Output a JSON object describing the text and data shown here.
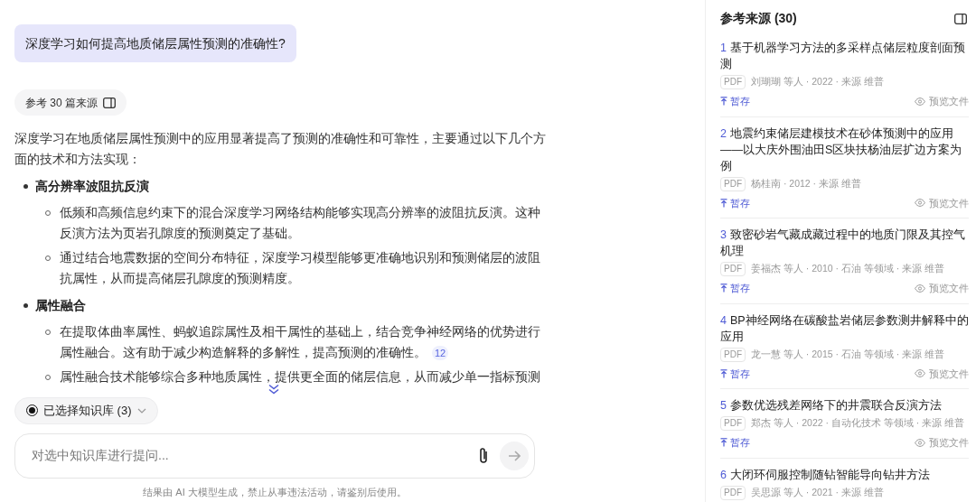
{
  "question": "深度学习如何提高地质储层属性预测的准确性?",
  "sources_chip": {
    "label": "参考 30 篇来源"
  },
  "answer": {
    "intro": "深度学习在地质储层属性预测中的应用显著提高了预测的准确性和可靠性，主要通过以下几个方面的技术和方法实现：",
    "sections": [
      {
        "heading": "高分辨率波阻抗反演",
        "points": [
          {
            "text": "低频和高频信息约束下的混合深度学习网络结构能够实现高分辨率的波阻抗反演。这种反演方法为页岩孔隙度的预测奠定了基础。"
          },
          {
            "text": "通过结合地震数据的空间分布特征，深度学习模型能够更准确地识别和预测储层的波阻抗属性，从而提高储层孔隙度的预测精度。"
          }
        ]
      },
      {
        "heading": "属性融合",
        "points": [
          {
            "text": "在提取体曲率属性、蚂蚁追踪属性及相干属性的基础上，结合竞争神经网络的优势进行属性融合。这有助于减少构造解释的多解性，提高预测的准确性。",
            "cite": "12"
          },
          {
            "text": "属性融合技术能够综合多种地质属性，提供更全面的储层信息，从而减少单一指标预测"
          }
        ]
      }
    ]
  },
  "kb_selector": {
    "label": "已选择知识库 (3)"
  },
  "composer": {
    "placeholder": "对选中知识库进行提问..."
  },
  "disclaimer": "结果由 AI 大模型生成，禁止从事违法活动，请鉴别后使用。",
  "sources_panel": {
    "title": "参考来源 (30)",
    "items": [
      {
        "number": "1",
        "title": "基于机器学习方法的多采样点储层粒度剖面预测",
        "badge": "PDF",
        "meta": "刘瑚瑚 等人 · 2022 · 来源 维普",
        "save_label": "暂存",
        "preview_label": "预览文件"
      },
      {
        "number": "2",
        "title": "地震约束储层建模技术在砂体预测中的应用——以大庆外围油田S区块扶杨油层扩边方案为例",
        "badge": "PDF",
        "meta": "杨桂南 · 2012 · 来源 维普",
        "save_label": "暂存",
        "preview_label": "预览文件"
      },
      {
        "number": "3",
        "title": "致密砂岩气藏成藏过程中的地质门限及其控气机理",
        "badge": "PDF",
        "meta": "姜福杰 等人 · 2010 · 石油 等领域 · 来源 维普",
        "save_label": "暂存",
        "preview_label": "预览文件"
      },
      {
        "number": "4",
        "title": "BP神经网络在碳酸盐岩储层参数测井解释中的应用",
        "badge": "PDF",
        "meta": "龙一慧 等人 · 2015 · 石油 等领域 · 来源 维普",
        "save_label": "暂存",
        "preview_label": "预览文件"
      },
      {
        "number": "5",
        "title": "参数优选残差网络下的井震联合反演方法",
        "badge": "PDF",
        "meta": "郑杰 等人 · 2022 · 自动化技术 等领域 · 来源 维普",
        "save_label": "暂存",
        "preview_label": "预览文件"
      },
      {
        "number": "6",
        "title": "大闭环伺服控制随钻智能导向钻井方法",
        "badge": "PDF",
        "meta": "吴思源 等人 · 2021 · 来源 维普"
      }
    ]
  }
}
